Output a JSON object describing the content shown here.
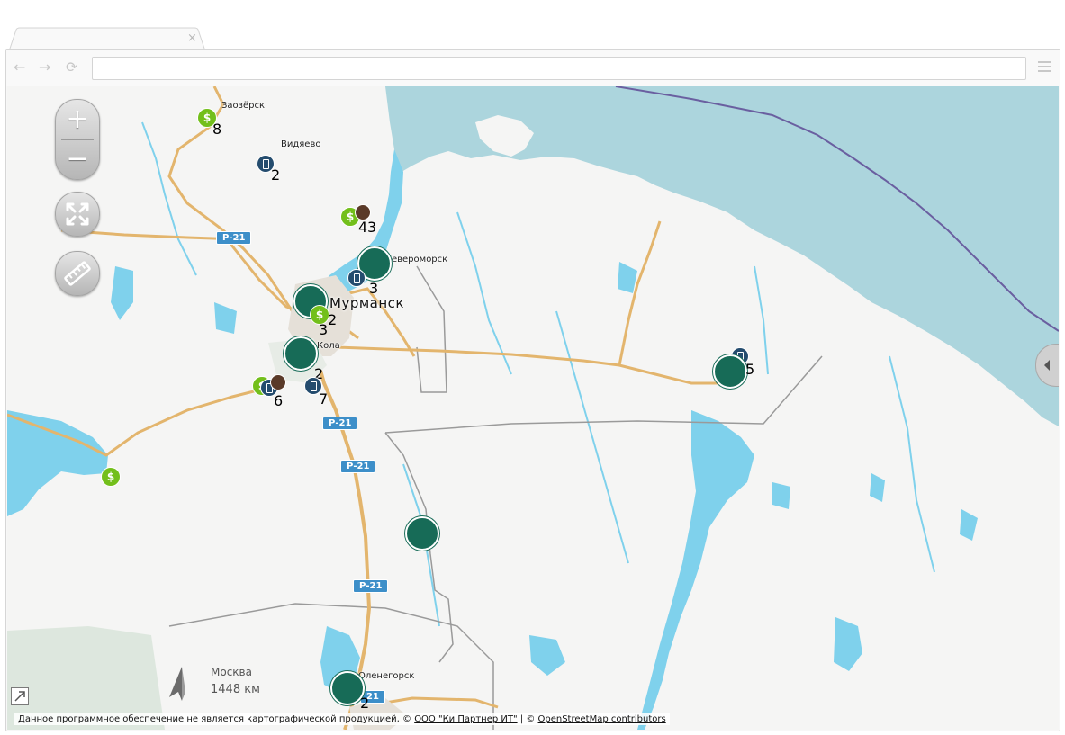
{
  "browser": {
    "tab_close": "×",
    "back": "←",
    "forward": "→",
    "reload": "⟳",
    "url": ""
  },
  "map": {
    "labels": {
      "zaozersk": "Заозёрск",
      "vidyaevo": "Видяево",
      "severomorsk": "Североморск",
      "murmansk": "Мурманск",
      "kola": "Кола",
      "olenegorsk": "Оленегорск"
    },
    "road_shields": [
      "Р-21",
      "Р-21",
      "Р-21",
      "Р-21",
      "21"
    ],
    "marker_counts": [
      "8",
      "2",
      "4",
      "3",
      "3",
      "2",
      "3",
      "2",
      "6",
      "7",
      "5",
      "2"
    ],
    "controls": {
      "zoom_in": "+",
      "zoom_out": "−"
    },
    "direction": {
      "city": "Москва",
      "distance": "1448 км"
    },
    "attribution": {
      "text": "Данное программное обеспечение не является картографической продукцией, © ",
      "partner_link": "ООО \"Ки Партнер ИТ\"",
      "sep": " | © ",
      "osm_link": "OpenStreetMap contributors"
    },
    "colors": {
      "land": "#f5f5f4",
      "water": "#acd5dd",
      "lake": "#7fd1ec",
      "road": "#e3b56d",
      "bank_marker": "#176b57",
      "money_marker": "#73bf1b",
      "atm_marker": "#244c6e"
    }
  }
}
